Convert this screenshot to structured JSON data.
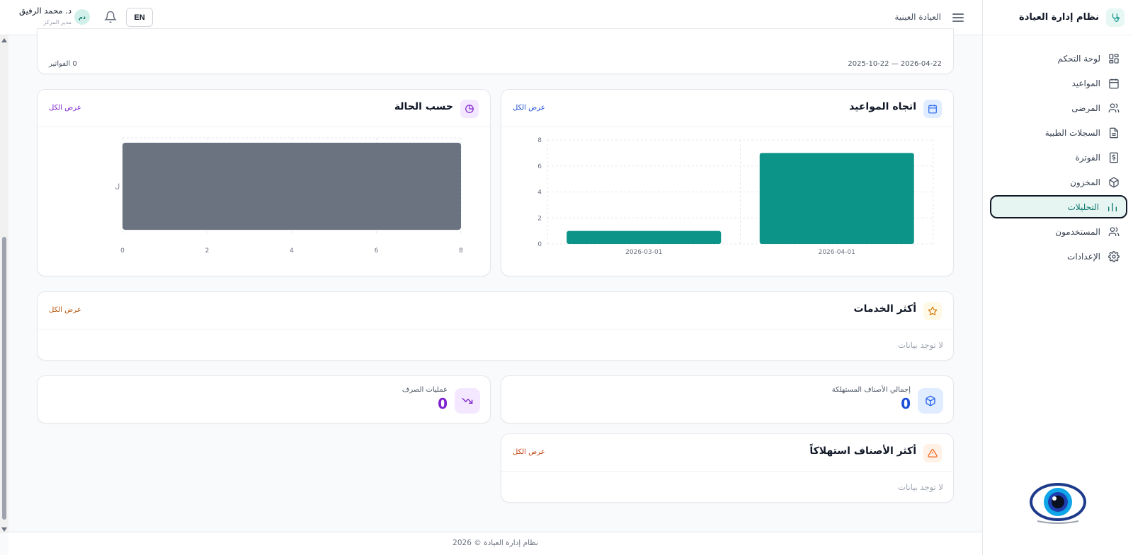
{
  "app": {
    "brand_title": "نظام إدارة العيادة"
  },
  "header": {
    "clinic_name": "العيادة العينية",
    "user_name": "د. محمد الرفيق",
    "user_role": "مدير المركز",
    "avatar_initials": "دم",
    "language_button": "EN"
  },
  "sidebar": {
    "items": [
      {
        "label": "لوحة التحكم",
        "icon": "dashboard-icon"
      },
      {
        "label": "المواعيد",
        "icon": "calendar-icon"
      },
      {
        "label": "المرضى",
        "icon": "users-icon"
      },
      {
        "label": "السجلات الطبية",
        "icon": "file-text-icon"
      },
      {
        "label": "الفوترة",
        "icon": "dollar-icon"
      },
      {
        "label": "المخزون",
        "icon": "package-icon"
      },
      {
        "label": "التحليلات",
        "icon": "bar-chart-icon",
        "active": true
      },
      {
        "label": "المستخدمون",
        "icon": "users-icon"
      },
      {
        "label": "الإعدادات",
        "icon": "gear-icon"
      }
    ]
  },
  "summary": {
    "date_range": "2025-10-22 — 2026-04-22",
    "invoices": "0 الفواتير"
  },
  "appointments_trend": {
    "title": "اتجاه المواعيد",
    "view_all": "عرض الكل",
    "color": "#0d9488"
  },
  "by_status": {
    "title": "حسب الحالة",
    "view_all": "عرض الكل",
    "bar_label_fragment": "ل",
    "color": "#6b7280"
  },
  "top_services": {
    "title": "أكثر الخدمات",
    "view_all": "عرض الكل",
    "empty": "لا توجد بيانات"
  },
  "stats": {
    "consumed_label": "إجمالي الأصناف المستهلكة",
    "consumed_value": "0",
    "dispense_label": "عمليات الصرف",
    "dispense_value": "0"
  },
  "top_consumed": {
    "title": "أكثر الأصناف استهلاكاً",
    "view_all": "عرض الكل",
    "empty": "لا توجد بيانات"
  },
  "footer": {
    "text": "نظام إدارة العيادة © 2026"
  },
  "colors": {
    "accent": "#0d9488",
    "purple": "#7e22ce",
    "blue": "#1d4ed8",
    "orange": "#c2410c"
  },
  "chart_data": [
    {
      "type": "bar",
      "title": "اتجاه المواعيد",
      "categories": [
        "2026-03-01",
        "2026-04-01"
      ],
      "values": [
        1,
        7
      ],
      "ylim": [
        0,
        8
      ],
      "yticks": [
        "0",
        "2",
        "4",
        "6",
        "8"
      ],
      "grid": true
    },
    {
      "type": "bar",
      "orientation": "horizontal",
      "title": "حسب الحالة",
      "categories": [
        "ل"
      ],
      "values": [
        8
      ],
      "xlim": [
        0,
        8
      ],
      "xticks": [
        "0",
        "2",
        "4",
        "6",
        "8"
      ],
      "grid": true
    }
  ]
}
